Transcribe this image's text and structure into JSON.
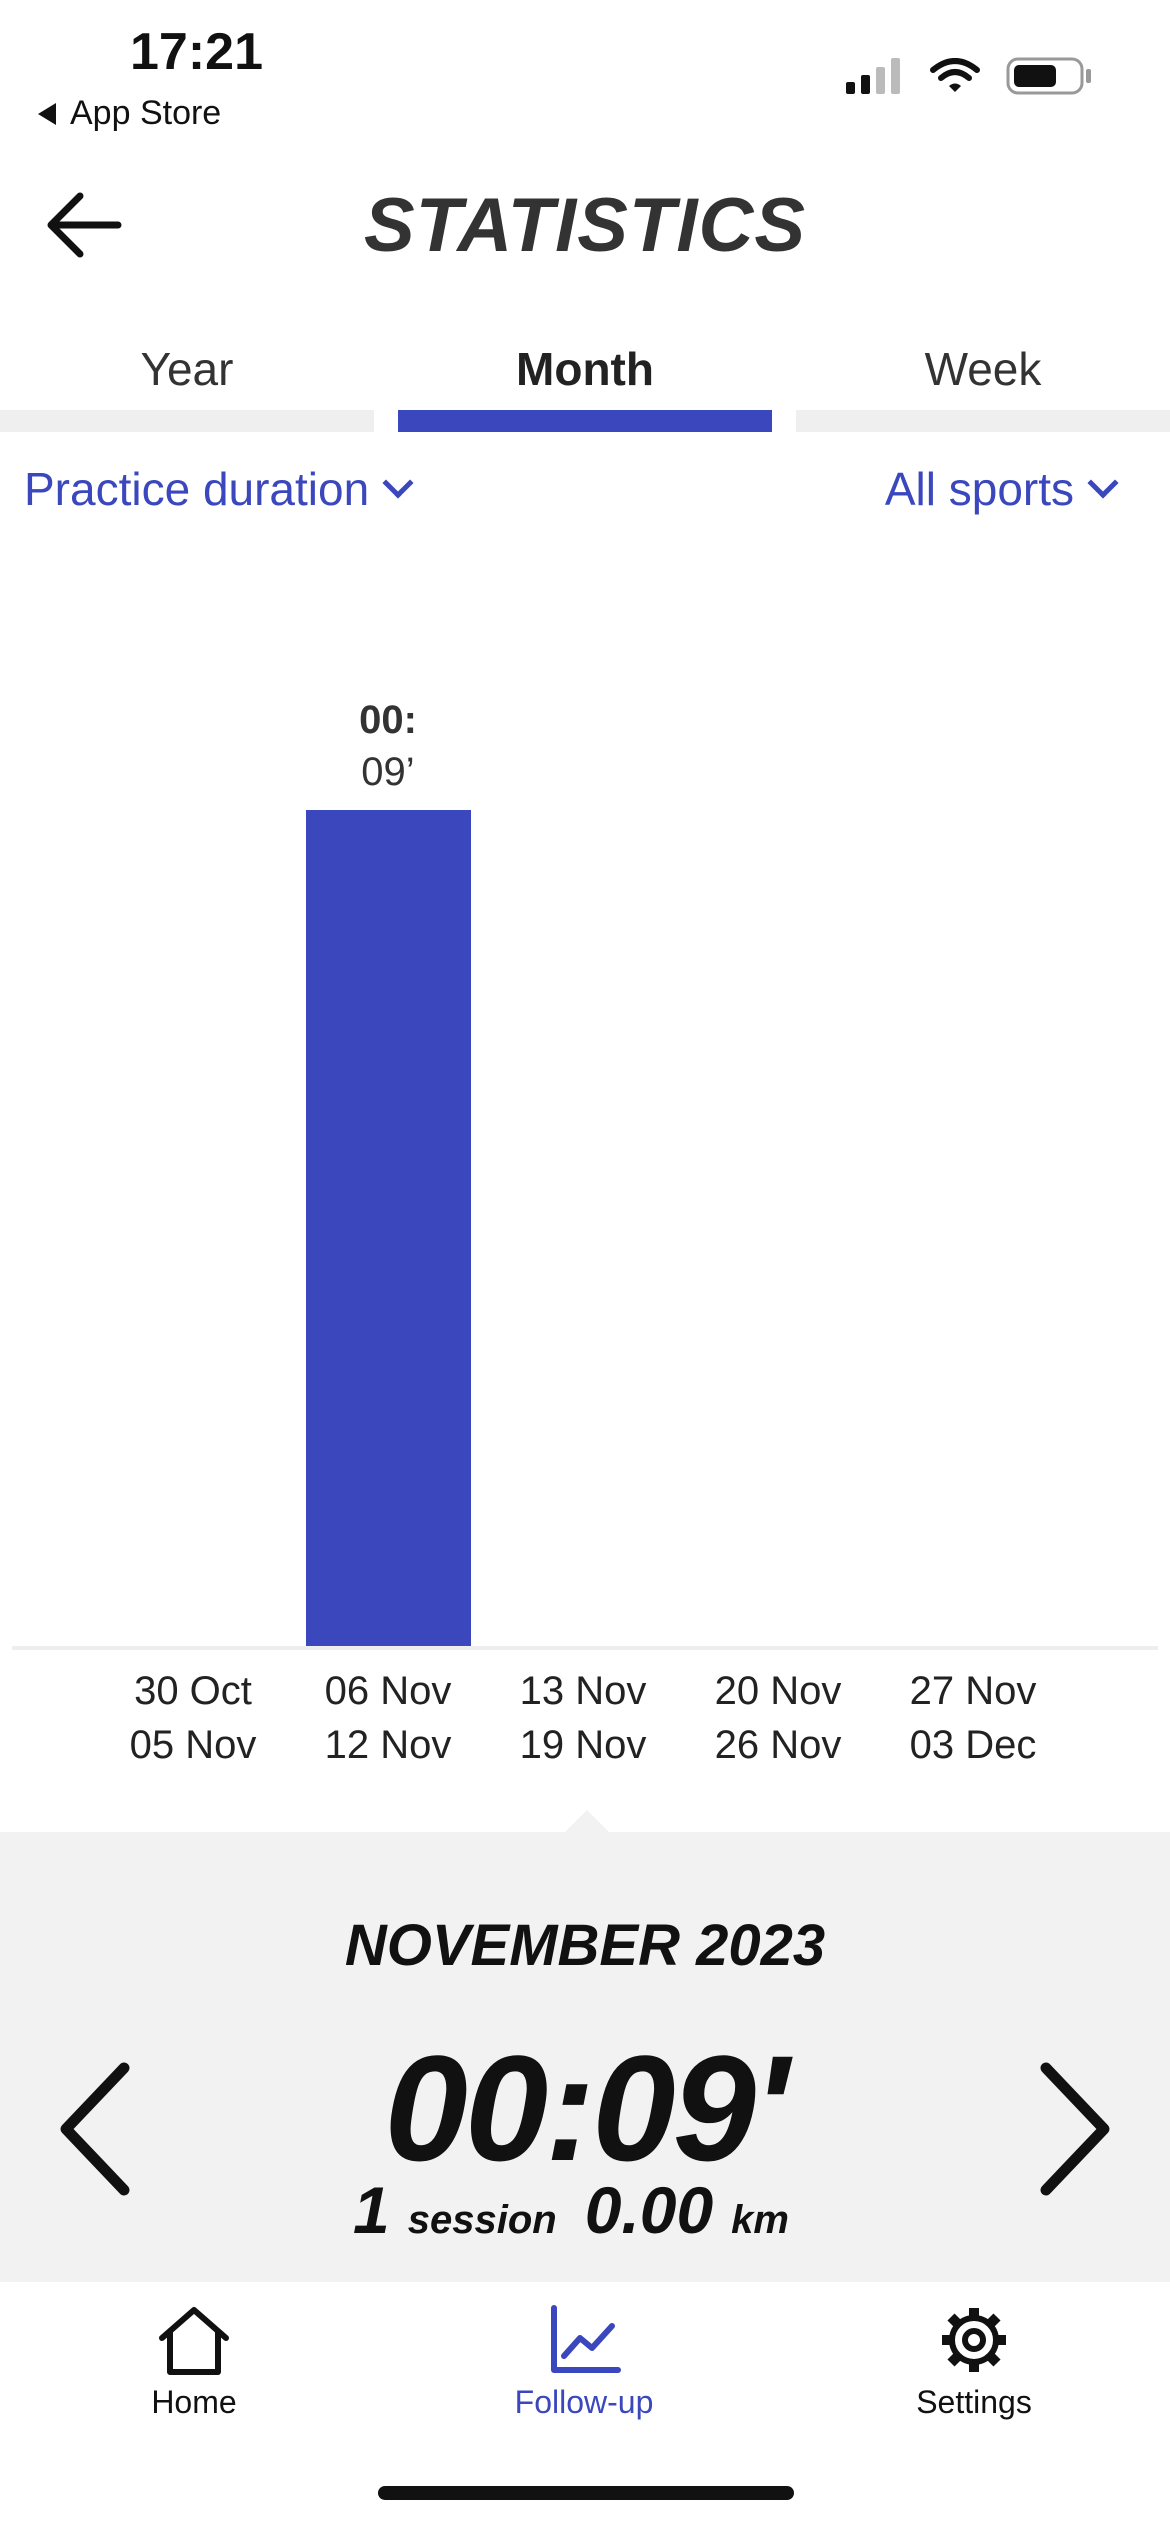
{
  "status_bar": {
    "time": "17:21",
    "back_app": "App Store",
    "icons": [
      "signal-icon",
      "wifi-icon",
      "battery-icon"
    ]
  },
  "header": {
    "title": "STATISTICS",
    "back_icon": "arrow-left-icon"
  },
  "tabs": [
    {
      "label": "Year",
      "active": false
    },
    {
      "label": "Month",
      "active": true
    },
    {
      "label": "Week",
      "active": false
    }
  ],
  "filters": {
    "metric": "Practice duration",
    "sport": "All sports"
  },
  "chart_data": {
    "type": "bar",
    "categories": [
      [
        "30 Oct",
        "05 Nov"
      ],
      [
        "06 Nov",
        "12 Nov"
      ],
      [
        "13 Nov",
        "19 Nov"
      ],
      [
        "20 Nov",
        "26 Nov"
      ],
      [
        "27 Nov",
        "03 Dec"
      ]
    ],
    "values": [
      0,
      9,
      0,
      0,
      0
    ],
    "value_unit": "minutes",
    "data_labels": [
      null,
      [
        "00:",
        "09’"
      ],
      null,
      null,
      null
    ],
    "ylim": [
      0,
      9
    ]
  },
  "summary": {
    "period": "NOVEMBER 2023",
    "duration": "00:09'",
    "sessions_value": "1",
    "sessions_unit": "session",
    "distance_value": "0.00",
    "distance_unit": "km"
  },
  "bottom_nav": [
    {
      "label": "Home",
      "icon": "home-icon",
      "active": false
    },
    {
      "label": "Follow-up",
      "icon": "chart-icon",
      "active": true
    },
    {
      "label": "Settings",
      "icon": "gear-icon",
      "active": false
    }
  ],
  "colors": {
    "accent": "#3a47bd",
    "panel_bg": "#f2f2f2",
    "tab_inactive": "#efefef"
  }
}
